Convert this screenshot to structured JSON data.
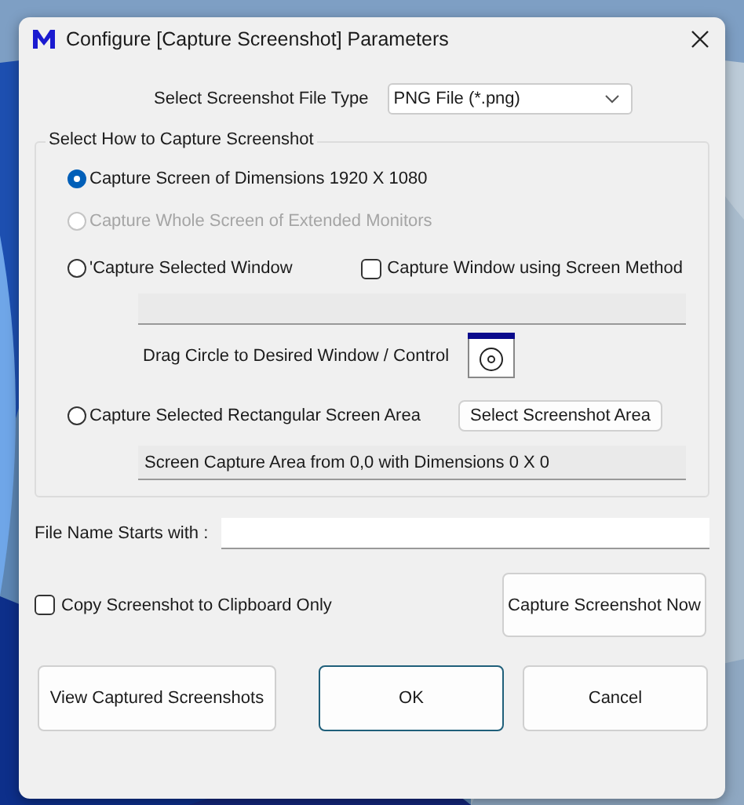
{
  "window": {
    "title": "Configure [Capture Screenshot] Parameters"
  },
  "file_type": {
    "label": "Select Screenshot File Type",
    "value": "PNG File (*.png)"
  },
  "capture_group": {
    "title": "Select How to Capture Screenshot",
    "options": [
      {
        "kind": "plain",
        "label": "Capture Screen of Dimensions 1920 X 1080",
        "selected": true,
        "disabled": false
      },
      {
        "kind": "plain",
        "label": "Capture Whole Screen of Extended Monitors",
        "selected": false,
        "disabled": true
      },
      {
        "kind": "window",
        "label": "'Capture Selected Window",
        "selected": false,
        "disabled": false,
        "checkbox": {
          "label": "Capture Window using Screen Method",
          "checked": false
        },
        "drag_label": "Drag Circle to Desired Window / Control"
      },
      {
        "kind": "area",
        "label": "Capture Selected Rectangular Screen Area",
        "selected": false,
        "disabled": false,
        "button": "Select Screenshot Area",
        "area_text": "Screen Capture Area from 0,0 with Dimensions 0 X 0"
      }
    ]
  },
  "file_name": {
    "label": "File Name Starts with :"
  },
  "clipboard": {
    "label": "Copy Screenshot to Clipboard Only",
    "checked": false
  },
  "capture_button": "Capture Screenshot Now",
  "buttons": [
    {
      "label": "View Captured Screenshots",
      "default": false
    },
    {
      "label": "OK",
      "default": true
    },
    {
      "label": "Cancel",
      "default": false
    }
  ]
}
